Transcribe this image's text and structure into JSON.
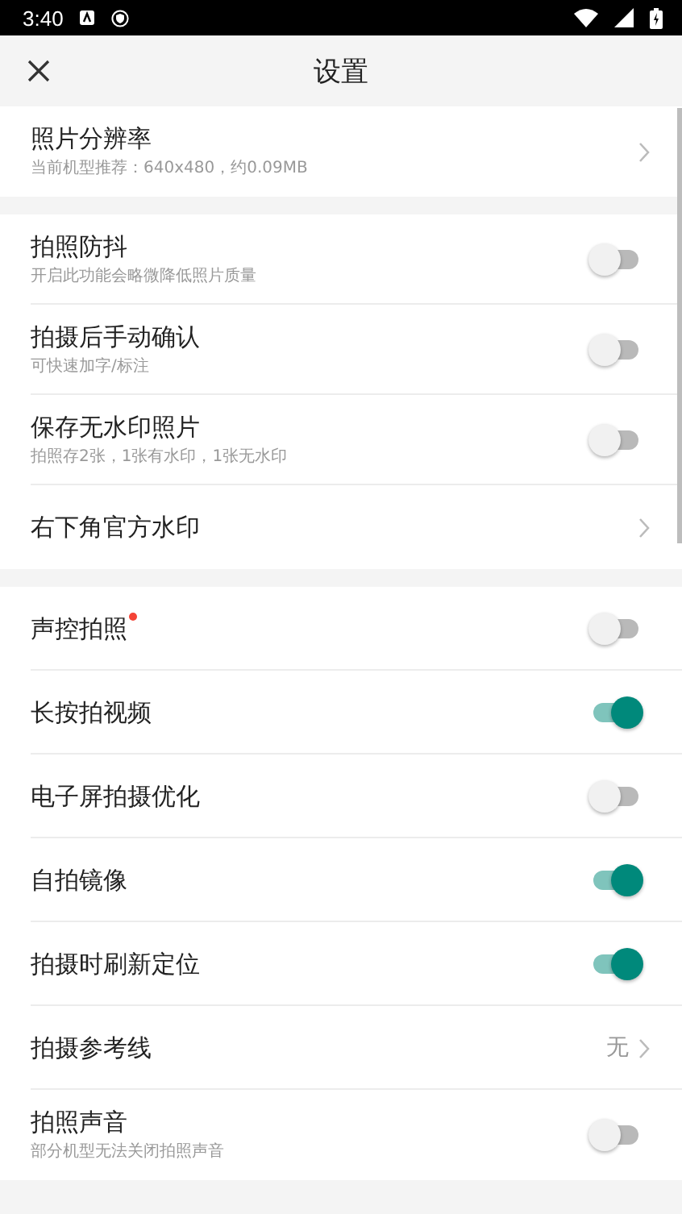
{
  "status_bar": {
    "time": "3:40"
  },
  "header": {
    "title": "设置"
  },
  "sections": [
    {
      "items": [
        {
          "kind": "link",
          "title": "照片分辨率",
          "subtitle": "当前机型推荐：640x480，约0.09MB"
        }
      ]
    },
    {
      "items": [
        {
          "kind": "toggle",
          "title": "拍照防抖",
          "subtitle": "开启此功能会略微降低照片质量",
          "on": false
        },
        {
          "kind": "toggle",
          "title": "拍摄后手动确认",
          "subtitle": "可快速加字/标注",
          "on": false
        },
        {
          "kind": "toggle",
          "title": "保存无水印照片",
          "subtitle": "拍照存2张，1张有水印，1张无水印",
          "on": false
        },
        {
          "kind": "link",
          "title": "右下角官方水印"
        }
      ]
    },
    {
      "items": [
        {
          "kind": "toggle",
          "title": "声控拍照",
          "on": false,
          "dot": true
        },
        {
          "kind": "toggle",
          "title": "长按拍视频",
          "on": true
        },
        {
          "kind": "toggle",
          "title": "电子屏拍摄优化",
          "on": false
        },
        {
          "kind": "toggle",
          "title": "自拍镜像",
          "on": true
        },
        {
          "kind": "toggle",
          "title": "拍摄时刷新定位",
          "on": true
        },
        {
          "kind": "link",
          "title": "拍摄参考线",
          "value": "无"
        },
        {
          "kind": "toggle",
          "title": "拍照声音",
          "subtitle": "部分机型无法关闭拍照声音",
          "on": false
        }
      ]
    }
  ]
}
